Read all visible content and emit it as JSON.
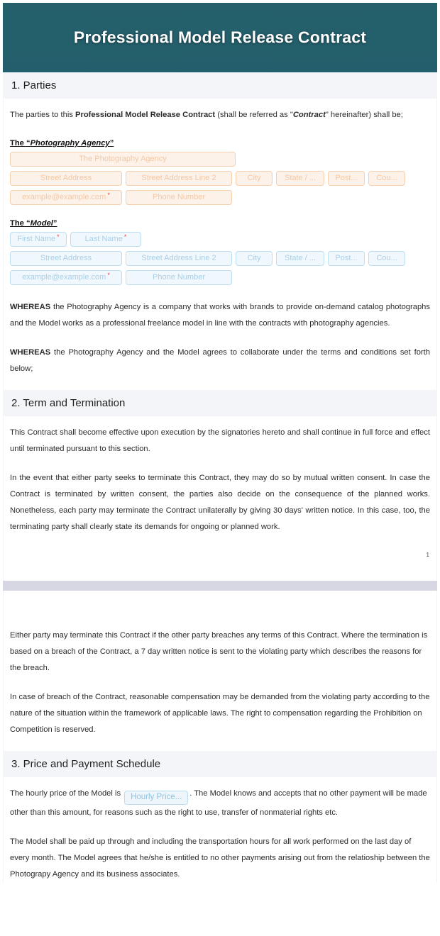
{
  "header": {
    "title": "Professional Model Release Contract",
    "banner_color": "#1d5a69",
    "title_color": "#ffffff"
  },
  "colors": {
    "agency_field_bg": "#fdf2e9",
    "agency_field_border": "#f6cfae",
    "agency_field_text": "#f2c8a6",
    "model_field_bg": "#f1f8fd",
    "model_field_border": "#bcdef1",
    "model_field_text": "#a9cfe6",
    "section_header_bg": "#f4f5f8",
    "page_break_bg": "#d6d7e3",
    "required_asterisk": "#e8443a"
  },
  "sections": {
    "parties": {
      "heading": "1. Parties",
      "intro_1": "The parties to this ",
      "intro_bold": "Professional Model Release Contract",
      "intro_2": " (shall be referred as \"",
      "intro_bolditalic": "Contract",
      "intro_3": "\" hereinafter) shall be;",
      "agency_label_prefix": "The “",
      "agency_label_em": "Photography Agency",
      "agency_label_suffix": "”",
      "model_label_prefix": "The “",
      "model_label_em": "Model",
      "model_label_suffix": "”",
      "whereas_1_bold": "WHEREAS",
      "whereas_1_text": " the Photography Agency is a company that works with brands to provide on-demand catalog photographs and the Model works as a professional freelance model in line with the contracts with photography agencies.",
      "whereas_2_bold": "WHEREAS",
      "whereas_2_text": " the Photography Agency and the Model agrees to collaborate under the terms and conditions set forth below;"
    },
    "term": {
      "heading": "2. Term and Termination",
      "p1": "This Contract shall become effective upon execution by the signatories hereto and shall continue in full force and effect until terminated pursuant to this section.",
      "p2": "In the event that either party seeks to terminate this Contract, they may do so by mutual written consent. In case the Contract is terminated by written consent, the parties also decide on the consequence of the planned works. Nonetheless, each party may terminate the Contract unilaterally by giving 30 days' written notice. In this case, too, the terminating party shall clearly state its demands for ongoing or planned work.",
      "p3": "Either party may terminate this Contract if the other party breaches any terms of this Contract. Where the termination is based on a breach of the Contract, a 7 day written notice is sent to the violating party which describes the reasons for the breach.",
      "p4": "In case of breach of the Contract, reasonable compensation may be demanded from the violating party according to the nature of the situation within the framework of applicable laws. The right to compensation regarding the Prohibition on Competition is reserved."
    },
    "price": {
      "heading": "3. Price and Payment Schedule",
      "p1_before": "The hourly price of the Model is ",
      "p1_after": ". The Model knows and accepts that no other payment will be made other than this amount, for reasons such as the right to use, transfer of nonmaterial rights etc.",
      "p2": "The Model shall be paid up through and including the transportation hours for all work performed on the last day of every month. The Model agrees that he/she is entitled to no other payments arising out from the relatioship between the Photograpy Agency and its business associates."
    }
  },
  "agency_fields": {
    "company": "The Photography Agency",
    "street": "Street Address",
    "street2": "Street Address Line 2",
    "city": "City",
    "state": "State / ...",
    "postal": "Post...",
    "country": "Cou...",
    "email": "example@example.com",
    "email_required": "*",
    "phone": "Phone Number"
  },
  "model_fields": {
    "first_name": "First Name",
    "first_name_required": "*",
    "last_name": "Last Name",
    "last_name_required": "*",
    "street": "Street Address",
    "street2": "Street Address Line 2",
    "city": "City",
    "state": "State / ...",
    "postal": "Post...",
    "country": "Cou...",
    "email": "example@example.com",
    "email_required": "*",
    "phone": "Phone Number"
  },
  "price_field": {
    "hourly_price": "Hourly Price..."
  },
  "footer": {
    "page_number": "1"
  }
}
